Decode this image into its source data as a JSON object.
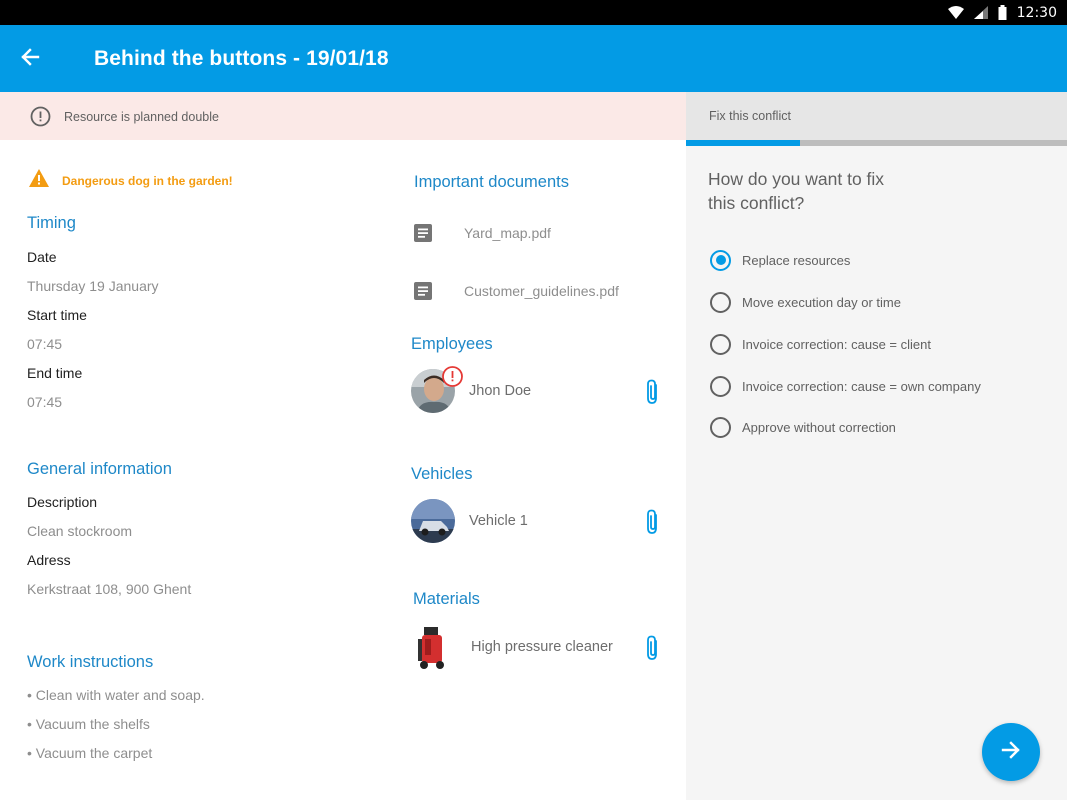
{
  "status_bar": {
    "time": "12:30",
    "icons": [
      "wifi-icon",
      "signal-icon",
      "battery-icon"
    ]
  },
  "app_bar": {
    "title": "Behind the buttons - 19/01/18",
    "back_icon": "arrow-back-icon"
  },
  "banner": {
    "text": "Resource is planned double",
    "icon": "alert-circle-icon"
  },
  "warning": {
    "text": "Dangerous dog in the garden!",
    "icon": "warning-triangle-icon"
  },
  "timing": {
    "title": "Timing",
    "date_label": "Date",
    "date_value": "Thursday 19 January",
    "start_label": "Start time",
    "start_value": "07:45",
    "end_label": "End time",
    "end_value": "07:45"
  },
  "general": {
    "title": "General information",
    "description_label": "Description",
    "description_value": "Clean stockroom",
    "address_label": "Adress",
    "address_value": "Kerkstraat 108, 900 Ghent"
  },
  "work_instructions": {
    "title": "Work instructions",
    "items": [
      "• Clean with water and soap.",
      "• Vacuum the shelfs",
      "• Vacuum the carpet"
    ]
  },
  "documents": {
    "title": "Important documents",
    "items": [
      "Yard_map.pdf",
      "Customer_guidelines.pdf"
    ]
  },
  "employees": {
    "title": "Employees",
    "name": "Jhon Doe"
  },
  "vehicles": {
    "title": "Vehicles",
    "name": "Vehicle 1"
  },
  "materials": {
    "title": "Materials",
    "name": "High pressure cleaner"
  },
  "conflict_panel": {
    "tab_label": "Fix this conflict",
    "progress": 0.3,
    "question": "How do you want to fix this conflict?",
    "options": [
      "Replace resources",
      "Move execution day or time",
      "Invoice correction: cause = client",
      "Invoice correction: cause = own company",
      "Approve without correction"
    ],
    "selected_index": 0,
    "next_icon": "arrow-forward-icon"
  },
  "colors": {
    "primary": "#039be5",
    "section_title": "#1e88c8",
    "warning": "#f39c12",
    "banner_bg": "#fbe9e7",
    "alert": "#e53935"
  }
}
